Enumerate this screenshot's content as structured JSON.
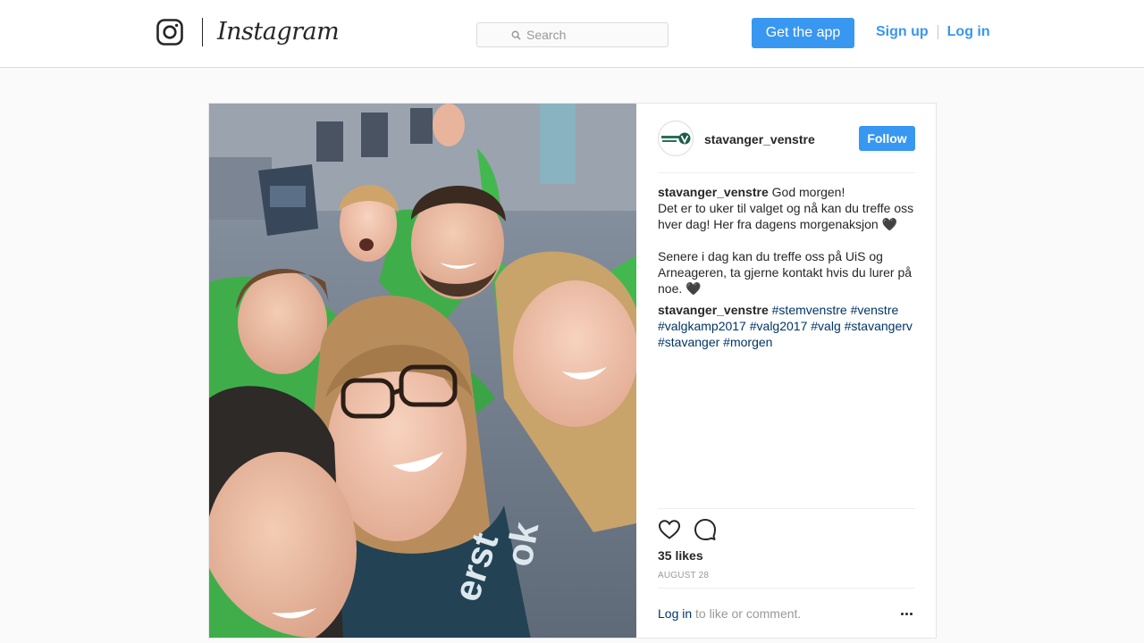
{
  "header": {
    "logo_text": "Instagram",
    "search_placeholder": "Search",
    "get_app_label": "Get the app",
    "signup_label": "Sign up",
    "login_label": "Log in",
    "accent_color": "#3897f0"
  },
  "post": {
    "username": "stavanger_venstre",
    "follow_label": "Follow",
    "caption": {
      "username": "stavanger_venstre",
      "line1": "God morgen!",
      "line2": "Det er to uker til valget og nå kan du treffe oss hver dag! Her fra dagens morgenaksjon 🖤",
      "line3": "Senere i dag kan du treffe oss på UiS og Arneageren, ta gjerne kontakt hvis du lurer på noe. 🖤"
    },
    "comment": {
      "username": "stavanger_venstre",
      "hashtags": [
        "#stemvenstre",
        "#venstre",
        "#valgkamp2017",
        "#valg2017",
        "#valg",
        "#stavangerv",
        "#stavanger",
        "#morgen"
      ]
    },
    "likes": "35 likes",
    "date": "AUGUST 28",
    "login_prompt_link": "Log in",
    "login_prompt_text": "to like or comment.",
    "icons": [
      "heart-icon",
      "comment-icon",
      "more-options-icon"
    ]
  }
}
